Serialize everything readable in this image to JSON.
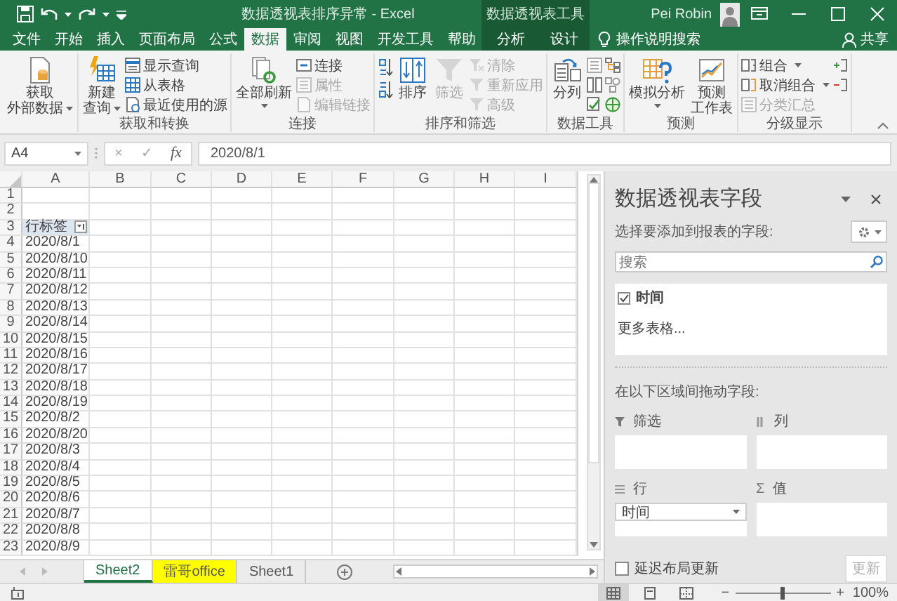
{
  "title_bar": {
    "title": "数据透视表排序异常 - Excel",
    "context_title": "数据透视表工具",
    "user": "Pei Robin"
  },
  "tabs": [
    {
      "label": "文件",
      "selected": false,
      "contextual": false
    },
    {
      "label": "开始",
      "selected": false,
      "contextual": false
    },
    {
      "label": "插入",
      "selected": false,
      "contextual": false
    },
    {
      "label": "页面布局",
      "selected": false,
      "contextual": false
    },
    {
      "label": "公式",
      "selected": false,
      "contextual": false
    },
    {
      "label": "数据",
      "selected": true,
      "contextual": false
    },
    {
      "label": "审阅",
      "selected": false,
      "contextual": false
    },
    {
      "label": "视图",
      "selected": false,
      "contextual": false
    },
    {
      "label": "开发工具",
      "selected": false,
      "contextual": false
    },
    {
      "label": "帮助",
      "selected": false,
      "contextual": false
    },
    {
      "label": "分析",
      "selected": false,
      "contextual": true
    },
    {
      "label": "设计",
      "selected": false,
      "contextual": true
    }
  ],
  "tell_me": "操作说明搜索",
  "share": "共享",
  "ribbon": {
    "groups": [
      {
        "items": [
          {
            "kind": "large",
            "lines": [
              "获取",
              "外部数据"
            ],
            "dropdown": true,
            "disabled": false
          }
        ]
      },
      {
        "label": "获取和转换",
        "items": [
          {
            "kind": "large",
            "lines": [
              "新建",
              "查询"
            ],
            "dropdown": true,
            "disabled": false
          },
          {
            "kind": "stack",
            "buttons": [
              {
                "label": "显示查询",
                "dropdown": false,
                "disabled": false
              },
              {
                "label": "从表格",
                "dropdown": false,
                "disabled": false
              },
              {
                "label": "最近使用的源",
                "dropdown": false,
                "disabled": false
              }
            ]
          }
        ]
      },
      {
        "label": "连接",
        "items": [
          {
            "kind": "large",
            "lines": [
              "全部刷新"
            ],
            "dropdown": true,
            "disabled": false
          },
          {
            "kind": "stack",
            "buttons": [
              {
                "label": "连接",
                "dropdown": false,
                "disabled": false
              },
              {
                "label": "属性",
                "dropdown": false,
                "disabled": true
              },
              {
                "label": "编辑链接",
                "dropdown": false,
                "disabled": true
              }
            ]
          }
        ]
      },
      {
        "label": "排序和筛选",
        "items": [
          {
            "kind": "sort_pair"
          },
          {
            "kind": "large",
            "lines": [
              "排序"
            ],
            "dropdown": false,
            "disabled": false
          },
          {
            "kind": "large",
            "lines": [
              "筛选"
            ],
            "dropdown": false,
            "disabled": true
          },
          {
            "kind": "stack",
            "buttons": [
              {
                "label": "清除",
                "dropdown": false,
                "disabled": true
              },
              {
                "label": "重新应用",
                "dropdown": false,
                "disabled": true
              },
              {
                "label": "高级",
                "dropdown": false,
                "disabled": true
              }
            ]
          }
        ]
      },
      {
        "label": "数据工具",
        "items": [
          {
            "kind": "large",
            "lines": [
              "分列"
            ],
            "dropdown": false,
            "disabled": false
          },
          {
            "kind": "tool_icons"
          },
          {
            "kind": "tool_icons"
          }
        ]
      },
      {
        "label": "预测",
        "items": [
          {
            "kind": "large",
            "lines": [
              "模拟分析"
            ],
            "dropdown": true,
            "disabled": false
          },
          {
            "kind": "large",
            "lines": [
              "预测",
              "工作表"
            ],
            "dropdown": false,
            "disabled": false
          }
        ]
      },
      {
        "label": "分级显示",
        "items": [
          {
            "kind": "stack",
            "buttons": [
              {
                "label": "组合",
                "dropdown": true,
                "disabled": false
              },
              {
                "label": "取消组合",
                "dropdown": true,
                "disabled": false
              },
              {
                "label": "分类汇总",
                "dropdown": false,
                "disabled": true
              }
            ]
          },
          {
            "kind": "outline_icons"
          }
        ]
      }
    ]
  },
  "formula_bar": {
    "name_box": "A4",
    "cancel": "×",
    "enter": "✓",
    "function": "fx",
    "formula": "2020/8/1"
  },
  "sheet": {
    "columns": [
      "A",
      "B",
      "C",
      "D",
      "E",
      "F",
      "G",
      "H",
      "I"
    ],
    "rows": [
      {
        "number": "1",
        "kind": "empty"
      },
      {
        "number": "2",
        "kind": "empty"
      },
      {
        "number": "3",
        "kind": "pivot_header",
        "a": "行标签"
      },
      {
        "number": "4",
        "kind": "value",
        "a": "2020/8/1"
      },
      {
        "number": "5",
        "kind": "value",
        "a": "2020/8/10"
      },
      {
        "number": "6",
        "kind": "value",
        "a": "2020/8/11"
      },
      {
        "number": "7",
        "kind": "value",
        "a": "2020/8/12"
      },
      {
        "number": "8",
        "kind": "value",
        "a": "2020/8/13"
      },
      {
        "number": "9",
        "kind": "value",
        "a": "2020/8/14"
      },
      {
        "number": "10",
        "kind": "value",
        "a": "2020/8/15"
      },
      {
        "number": "11",
        "kind": "value",
        "a": "2020/8/16"
      },
      {
        "number": "12",
        "kind": "value",
        "a": "2020/8/17"
      },
      {
        "number": "13",
        "kind": "value",
        "a": "2020/8/18"
      },
      {
        "number": "14",
        "kind": "value",
        "a": "2020/8/19"
      },
      {
        "number": "15",
        "kind": "value",
        "a": "2020/8/2"
      },
      {
        "number": "16",
        "kind": "value",
        "a": "2020/8/20"
      },
      {
        "number": "17",
        "kind": "value",
        "a": "2020/8/3"
      },
      {
        "number": "18",
        "kind": "value",
        "a": "2020/8/4"
      },
      {
        "number": "19",
        "kind": "value",
        "a": "2020/8/5"
      },
      {
        "number": "20",
        "kind": "value",
        "a": "2020/8/6"
      },
      {
        "number": "21",
        "kind": "value",
        "a": "2020/8/7"
      },
      {
        "number": "22",
        "kind": "value",
        "a": "2020/8/8"
      },
      {
        "number": "23",
        "kind": "value",
        "a": "2020/8/9"
      }
    ]
  },
  "pivot_pane": {
    "title": "数据透视表字段",
    "prompt": "选择要添加到报表的字段:",
    "search_placeholder": "搜索",
    "fields": [
      {
        "label": "时间",
        "checked": true
      }
    ],
    "more_tables": "更多表格...",
    "areas_prompt": "在以下区域间拖动字段:",
    "areas": [
      {
        "kind": "filter",
        "label": "筛选"
      },
      {
        "kind": "columns",
        "label": "列"
      },
      {
        "kind": "rows",
        "label": "行",
        "fields": [
          "时间"
        ]
      },
      {
        "kind": "values",
        "label": "值",
        "symbol": "Σ"
      }
    ],
    "defer": {
      "label": "延迟布局更新",
      "checked": false
    },
    "update": {
      "label": "更新",
      "disabled": true
    }
  },
  "sheet_tabs": [
    {
      "label": "Sheet2",
      "selected": true
    },
    {
      "label": "雷哥office",
      "selected": false,
      "color": "#ffff00"
    },
    {
      "label": "Sheet1",
      "selected": false
    }
  ],
  "status_bar": {
    "views": [
      {
        "kind": "normal",
        "selected": true
      },
      {
        "kind": "page_layout",
        "selected": false
      },
      {
        "kind": "page_break",
        "selected": false
      }
    ],
    "zoom_out": "−",
    "zoom_in": "+",
    "zoom_slider": {
      "level": 0.5
    },
    "zoom": "100%"
  }
}
